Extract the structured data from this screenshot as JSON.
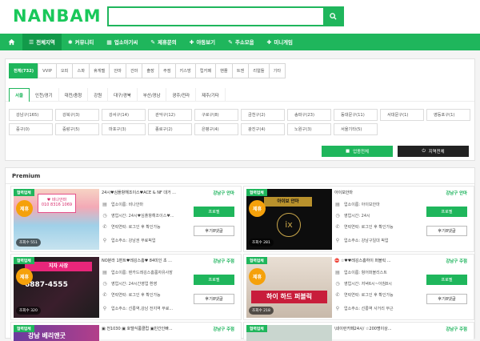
{
  "logo": "NANBAM",
  "nav": {
    "home_icon": "home-icon",
    "items": [
      {
        "icon": "list",
        "label": "전체지역"
      },
      {
        "icon": "users",
        "label": "커뮤니티"
      },
      {
        "icon": "board",
        "label": "업소야기씨"
      },
      {
        "icon": "tag",
        "label": "제휴문의"
      },
      {
        "icon": "heart",
        "label": "야동보기"
      },
      {
        "icon": "tag",
        "label": "주소모음"
      },
      {
        "icon": "plus",
        "label": "미니게임"
      }
    ]
  },
  "tabs": [
    "전체(732)",
    "VVIP",
    "오피",
    "스파",
    "휴게텔",
    "안마",
    "건마",
    "출장",
    "주점",
    "키스방",
    "립카페",
    "핸플",
    "트젠",
    "리얼돌",
    "기타"
  ],
  "subtabs": [
    "서울",
    "인천/경기",
    "대전/충청",
    "강원",
    "대구/경북",
    "부산/경남",
    "광주/전라",
    "제주/기타"
  ],
  "areas": [
    "강남구(165)",
    "강북구(3)",
    "강서구(14)",
    "관악구(12)",
    "구로구(8)",
    "금천구(2)",
    "송파구(23)",
    "동대문구(11)",
    "서대문구(1)",
    "영등포구(1)",
    "중구(0)",
    "중랑구(5)",
    "마포구(3)",
    "종로구(2)",
    "은평구(4)",
    "광진구(4)",
    "노원구(3)",
    "서울기타(5)"
  ],
  "btn_all": "업종전체",
  "btn_area": "지역전체",
  "premium_title": "Premium",
  "cards": [
    {
      "badge": "협력업체",
      "jehyu": "제휴",
      "views": "조회수 551",
      "title": "24시♥심플항해조이스♥ACE & NF 대거 ...",
      "category": "강남구 안마",
      "name": "업소이름: 비나안마",
      "hours": "영업시간: 24시♥심플항해조이스♥...",
      "phone": "연락연락: 로그인 후 확인가능",
      "addr": "업소주소: 강남권 무료픽업",
      "b1": "프로필",
      "b2": "후기8댓글"
    },
    {
      "badge": "협력업체",
      "jehyu": "제휴",
      "views": "조회수 281",
      "title": "아이보안마",
      "category": "강남구 안마",
      "name": "업소이름: 아이보안마",
      "hours": "영업시간: 24시",
      "phone": "연락연락: 로그인 후 확인가능",
      "addr": "업소주소: 강남구일대 픽업",
      "b1": "프로필",
      "b2": "후기8댓글"
    },
    {
      "badge": "협력업체",
      "jehyu": "제휴",
      "views": "조회수 320",
      "title": "NO분라 1편트♥레깅스홈♥ 84미인 초 ...",
      "category": "강남구 주점",
      "name": "업소이름: 텐카드레깅스홈룸자유사장",
      "hours": "영업시간: 24시간영업 환영",
      "phone": "연락연락: 로그인 후 확인가능",
      "addr": "업소주소: 선릉역,강남 전지역 무료...",
      "b1": "프로필",
      "b2": "후기8댓글"
    },
    {
      "badge": "협력업체",
      "jehyu": "제휴",
      "views": "조회수 218",
      "title": "⛔ ☆♥♥레깅스홈하이 퍼블릭 ...",
      "category": "강남구 주점",
      "name": "업소이름: 헝어퍼블리스트",
      "hours": "영업시간: 저녁6시~아침8시",
      "phone": "연락연락: 로그인 후 확인가능",
      "addr": "업소주소: 선릉역 사거리 부근",
      "b1": "프로필",
      "b2": "후기8댓글"
    },
    {
      "badge": "협력업체",
      "title": "▣ 전1030 ▣ 호텔식룸클럽 ▣민간인빠...",
      "category": "강남구 주점"
    },
    {
      "badge": "협력업체",
      "title": "\\네이런카페24시/ ☆200명이상...",
      "category": "강남구 주점"
    }
  ],
  "colors": {
    "green": "#1fb65c",
    "dark": "#222222",
    "orange": "#f5a10b"
  }
}
